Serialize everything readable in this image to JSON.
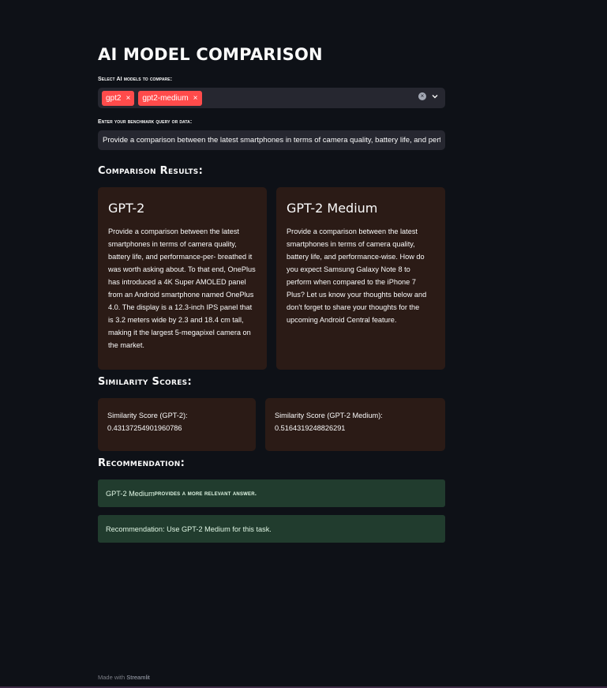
{
  "app": {
    "title": "AI MODEL COMPARISON"
  },
  "model_select": {
    "label": "Select AI models to compare:",
    "selected": [
      "gpt2",
      "gpt2-medium"
    ],
    "remove_glyph": "×",
    "clear_glyph": "×"
  },
  "query": {
    "label": "Enter your benchmark query or data:",
    "value": "Provide a comparison between the latest smartphones in terms of camera quality, battery life, and performance."
  },
  "results": {
    "heading": "Comparison Results:",
    "cards": [
      {
        "title": "GPT-2",
        "text": "Provide a comparison between the latest smartphones in terms of camera quality, battery life, and performance-per- breathed it was worth asking about. To that end, OnePlus has introduced a 4K Super AMOLED panel from an Android smartphone named OnePlus 4.0. The display is a 12.3-inch IPS panel that is 3.2 meters wide by 2.3 and 18.4 cm tall, making it the largest 5-megapixel camera on the market."
      },
      {
        "title": "GPT-2 Medium",
        "text": "Provide a comparison between the latest smartphones in terms of camera quality, battery life, and performance-wise. How do you expect Samsung Galaxy Note 8 to perform when compared to the iPhone 7 Plus? Let us know your thoughts below and don't forget to share your thoughts for the upcoming Android Central feature."
      }
    ]
  },
  "similarity": {
    "heading": "Similarity Scores:",
    "scores": [
      {
        "label": "Similarity Score (GPT-2):",
        "value": "0.43137254901960786"
      },
      {
        "label": "Similarity Score (GPT-2 Medium):",
        "value": "0.5164319248826291"
      }
    ]
  },
  "recommendation": {
    "heading": "Recommendation:",
    "winner": "GPT-2 Medium",
    "winner_suffix": "provides a more relevant answer.",
    "message": "Recommendation: Use GPT-2 Medium for this task."
  },
  "footer": {
    "made_with": "Made with",
    "brand": "Streamlit"
  },
  "colors": {
    "background": "#0e1117",
    "accent": "#ff4b4b",
    "card": "#2b1b16",
    "success": "#213c2e"
  },
  "icons": [
    "close-icon",
    "clear-icon",
    "chevron-down-icon"
  ]
}
